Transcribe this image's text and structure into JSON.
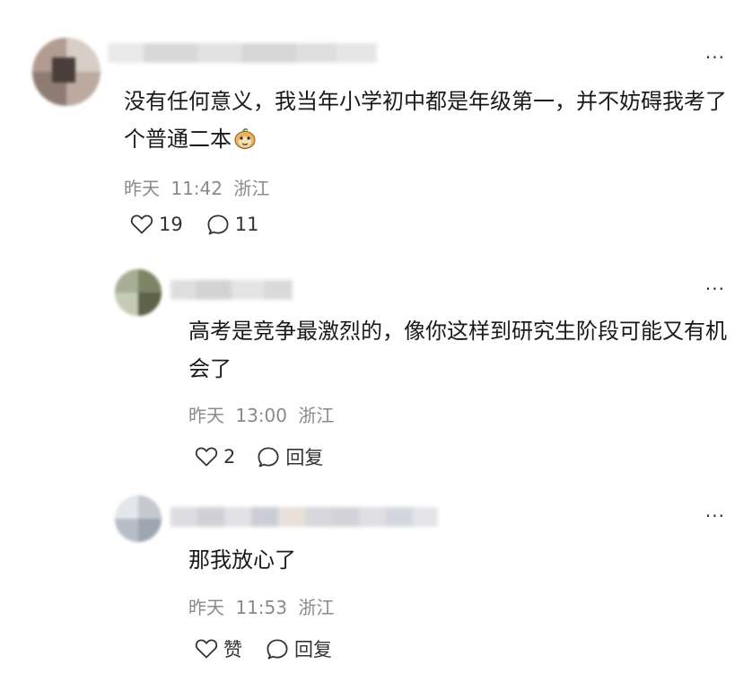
{
  "comments": [
    {
      "text": "没有任何意义，我当年小学初中都是年级第一，并不妨碍我考了个普通二本",
      "emoji": "monkey-face-emoji",
      "date": "昨天",
      "time": "11:42",
      "location": "浙江",
      "like_count": "19",
      "reply_count": "11",
      "more_label": "···"
    },
    {
      "text": "高考是竞争最激烈的，像你这样到研究生阶段可能又有机会了",
      "date": "昨天",
      "time": "13:00",
      "location": "浙江",
      "like_count": "2",
      "reply_label": "回复",
      "more_label": "···"
    },
    {
      "text": "那我放心了",
      "date": "昨天",
      "time": "11:53",
      "location": "浙江",
      "like_label": "赞",
      "reply_label": "回复",
      "more_label": "···"
    }
  ],
  "icons": {
    "like": "heart-outline-icon",
    "reply": "speech-bubble-icon",
    "more": "ellipsis-icon"
  },
  "colors": {
    "meta_text": "#8a8a8a",
    "body_text": "#1a1a1a"
  }
}
